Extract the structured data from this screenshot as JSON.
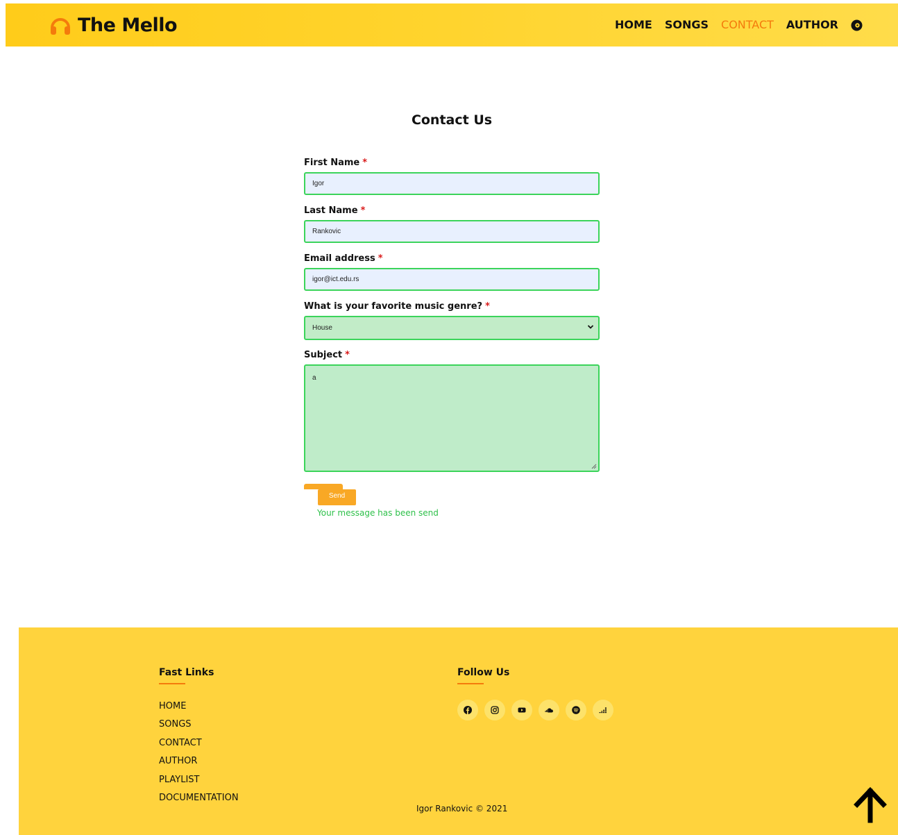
{
  "header": {
    "logo_text": "The Mello",
    "nav": [
      {
        "label": "HOME",
        "active": false
      },
      {
        "label": "SONGS",
        "active": false
      },
      {
        "label": "CONTACT",
        "active": true
      },
      {
        "label": "AUTHOR",
        "active": false
      }
    ]
  },
  "main": {
    "title": "Contact Us",
    "form": {
      "first_name": {
        "label": "First Name",
        "required": "*",
        "value": "Igor"
      },
      "last_name": {
        "label": "Last Name",
        "required": "*",
        "value": "Rankovic"
      },
      "email": {
        "label": "Email address",
        "required": "*",
        "value": "igor@ict.edu.rs"
      },
      "genre": {
        "label": "What is your favorite music genre?",
        "required": "*",
        "value": "House"
      },
      "subject": {
        "label": "Subject",
        "required": "*",
        "value": "a"
      },
      "send_label": "Send",
      "success_message": "Your message has been send"
    }
  },
  "footer": {
    "fast_links_heading": "Fast Links",
    "fast_links": [
      "HOME",
      "SONGS",
      "CONTACT",
      "AUTHOR",
      "PLAYLIST",
      "DOCUMENTATION"
    ],
    "follow_heading": "Follow Us",
    "socials": [
      "facebook-icon",
      "instagram-icon",
      "youtube-icon",
      "soundcloud-icon",
      "spotify-icon",
      "deezer-icon"
    ],
    "copyright": "Igor Rankovic © 2021"
  },
  "colors": {
    "header_bg": "#ffcc1a",
    "accent": "#f47b0c",
    "field_border": "#3bd45a",
    "button": "#f9a825",
    "success": "#2ec04a",
    "footer_bg": "#ffd33d"
  }
}
